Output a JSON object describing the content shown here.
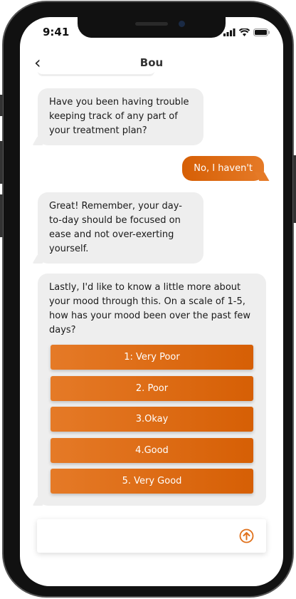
{
  "status_bar": {
    "time": "9:41"
  },
  "header": {
    "title": "Bou"
  },
  "messages": [
    {
      "from": "bot",
      "text": "Have you been having trouble keeping track of any part of your treatment plan?"
    },
    {
      "from": "user",
      "text": "No, I haven't"
    },
    {
      "from": "bot",
      "text": "Great! Remember, your day-to-day should be focused on ease and not over-exerting yourself."
    },
    {
      "from": "bot",
      "text": "Lastly, I'd like to know a little more about your mood through this. On a scale of 1-5, how has your mood been over the past few days?"
    }
  ],
  "options": [
    "1: Very Poor",
    "2. Poor",
    "3.Okay",
    "4.Good",
    "5. Very Good"
  ],
  "input": {
    "value": "",
    "placeholder": ""
  },
  "colors": {
    "accent": "#E0701A",
    "bubble": "#EEEEEE"
  }
}
